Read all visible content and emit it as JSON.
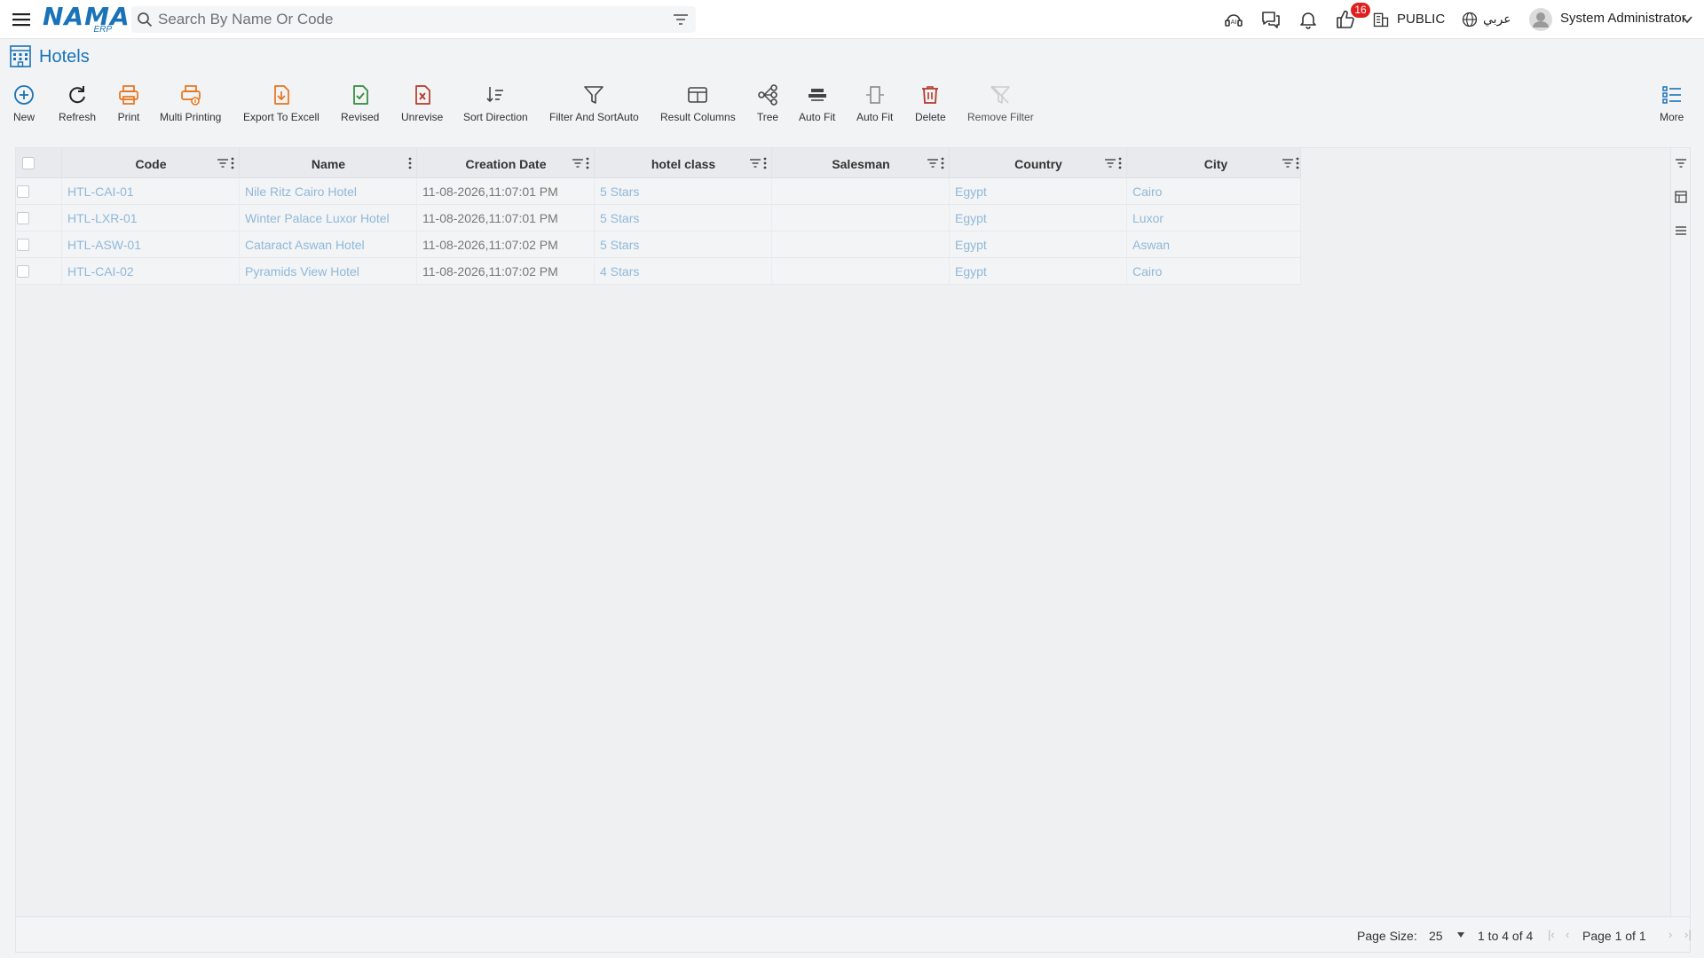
{
  "topbar": {
    "search_placeholder": "Search By Name Or Code",
    "logo_text": "NAMA",
    "logo_sub": "ERP",
    "notification_count": "16",
    "public_label": "PUBLIC",
    "language_label": "عربي",
    "user_name": "System Administrator"
  },
  "page": {
    "title": "Hotels"
  },
  "toolbar": {
    "new": "New",
    "refresh": "Refresh",
    "print": "Print",
    "multi_printing": "Multi Printing",
    "export_excel": "Export To Excell",
    "revised": "Revised",
    "unrevise": "Unrevise",
    "sort_direction": "Sort Direction",
    "filter_sort": "Filter And SortAuto",
    "result_columns": "Result Columns",
    "tree": "Tree",
    "auto_fit_1": "Auto Fit",
    "auto_fit_2": "Auto Fit",
    "delete": "Delete",
    "remove_filter": "Remove Filter",
    "more": "More"
  },
  "grid": {
    "columns": [
      "Code",
      "Name",
      "Creation Date",
      "hotel class",
      "Salesman",
      "Country",
      "City"
    ],
    "rows": [
      [
        "HTL-CAI-01",
        "Nile Ritz Cairo Hotel",
        "11-08-2026,11:07:01 PM",
        "5 Stars",
        "",
        "Egypt",
        "Cairo"
      ],
      [
        "HTL-LXR-01",
        "Winter Palace Luxor Hotel",
        "11-08-2026,11:07:01 PM",
        "5 Stars",
        "",
        "Egypt",
        "Luxor"
      ],
      [
        "HTL-ASW-01",
        "Cataract Aswan Hotel",
        "11-08-2026,11:07:02 PM",
        "5 Stars",
        "",
        "Egypt",
        "Aswan"
      ],
      [
        "HTL-CAI-02",
        "Pyramids View Hotel",
        "11-08-2026,11:07:02 PM",
        "4 Stars",
        "",
        "Egypt",
        "Cairo"
      ]
    ]
  },
  "footer": {
    "page_size_label": "Page Size:",
    "page_size_value": "25",
    "range": "1 to 4 of 4",
    "page_of": "Page 1 of 1"
  },
  "colors": {
    "brand": "#1a73b8",
    "link": "#8fb8d8",
    "badge": "#e02020"
  }
}
